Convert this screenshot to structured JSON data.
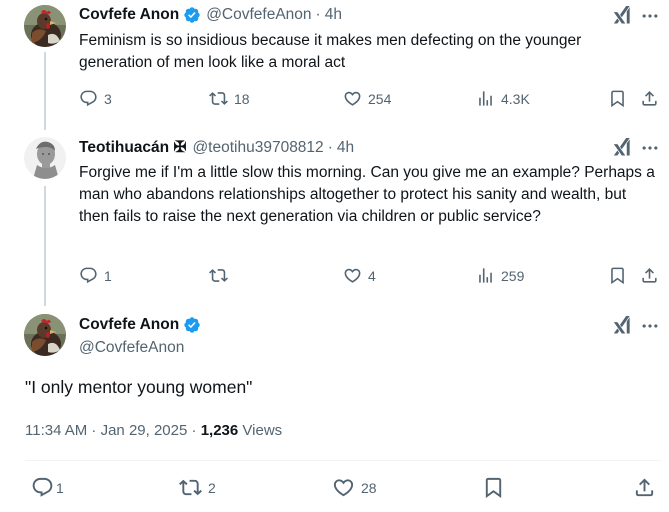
{
  "tweets": [
    {
      "name": "Covfefe Anon",
      "handle": "@CovfefeAnon",
      "sep": "·",
      "time": "4h",
      "text": "Feminism is so insidious because it makes men defecting on the younger generation of men look like a moral act",
      "replies": "3",
      "retweets": "18",
      "likes": "254",
      "views": "4.3K",
      "verified": true
    },
    {
      "name": "Teotihuacán ✠",
      "handle": "@teotihu39708812",
      "sep": "·",
      "time": "4h",
      "text": "Forgive me if I'm a little slow this morning. Can you give me an example? Perhaps a man who abandons relationships altogether to protect his sanity and wealth, but then fails to raise the next generation via children or public service?",
      "replies": "1",
      "retweets": "",
      "likes": "4",
      "views": "259",
      "verified": false
    }
  ],
  "main_tweet": {
    "name": "Covfefe Anon",
    "handle": "@CovfefeAnon",
    "text": "\"I only mentor young women\"",
    "timestamp": "11:34 AM · Jan 29, 2025",
    "dot": "·",
    "views_count": "1,236",
    "views_label": "Views",
    "replies": "1",
    "retweets": "2",
    "likes": "28"
  },
  "colors": {
    "accent": "#1d9bf0",
    "secondary_text": "#536471",
    "primary_text": "#0f1419",
    "thread_line": "#cfd9de"
  },
  "icons": [
    "grok-icon",
    "more-icon",
    "reply-icon",
    "retweet-icon",
    "like-icon",
    "views-icon",
    "bookmark-icon",
    "share-icon",
    "verified-badge-icon"
  ]
}
